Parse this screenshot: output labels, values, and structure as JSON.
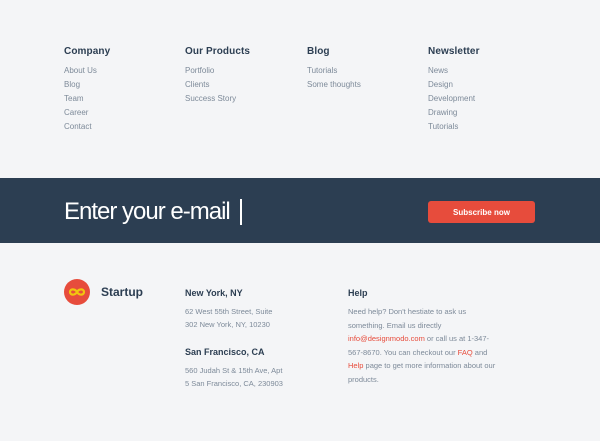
{
  "columns": [
    {
      "title": "Company",
      "items": [
        "About Us",
        "Blog",
        "Team",
        "Career",
        "Contact"
      ]
    },
    {
      "title": "Our Products",
      "items": [
        "Portfolio",
        "Clients",
        "Success Story"
      ]
    },
    {
      "title": "Blog",
      "items": [
        "Tutorials",
        "Some thoughts"
      ]
    },
    {
      "title": "Newsletter",
      "items": [
        "News",
        "Design",
        "Development",
        "Drawing",
        "Tutorials"
      ]
    }
  ],
  "subscribe": {
    "placeholder": "Enter your e-mail",
    "button_label": "Subscribe now"
  },
  "brand": {
    "name": "Startup",
    "icon": "infinity-icon",
    "logo_color": "#e74c3c",
    "logo_symbol_color": "#f1c40f"
  },
  "offices": [
    {
      "city": "New York, NY",
      "line1": "62 West 55th Street, Suite",
      "line2": "302 New York, NY, 10230"
    },
    {
      "city": "San Francisco, CA",
      "line1": "560 Judah St & 15th Ave, Apt",
      "line2": "5 San Francisco, CA, 230903"
    }
  ],
  "help": {
    "title": "Help",
    "text1": "Need help? Don't hestiate to ask us something. Email us directly ",
    "email": "info@designmodo.com",
    "text2": " or call us at 1-347-567-8670. You can checkout our ",
    "faq": "FAQ",
    "and": " and ",
    "help_link": "Help",
    "text3": " page to get more information about our products."
  },
  "colors": {
    "background": "#f4f5f7",
    "band": "#2c3e52",
    "accent": "#e74c3c",
    "heading": "#2c3e52",
    "muted": "#7d8a99"
  }
}
